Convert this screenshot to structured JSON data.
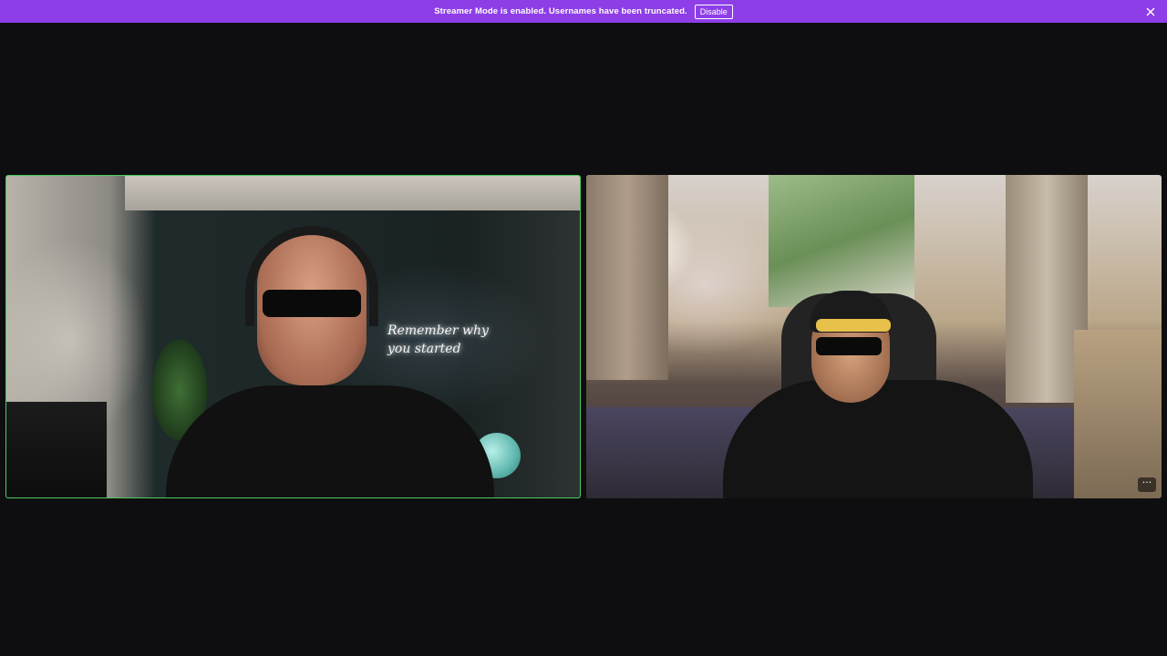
{
  "notice": {
    "message": "Streamer Mode is enabled. Usernames have been truncated.",
    "disable_label": "Disable",
    "background_color": "#8d3ee7",
    "close_icon": "close-icon"
  },
  "tiles": [
    {
      "id": "left",
      "active_speaker": true,
      "border_color": "#4ecb5c",
      "neon_sign_line1": "Remember why",
      "neon_sign_line2": "you started"
    },
    {
      "id": "right",
      "active_speaker": false,
      "more_icon": "ellipsis-icon",
      "more_label": "···"
    }
  ]
}
